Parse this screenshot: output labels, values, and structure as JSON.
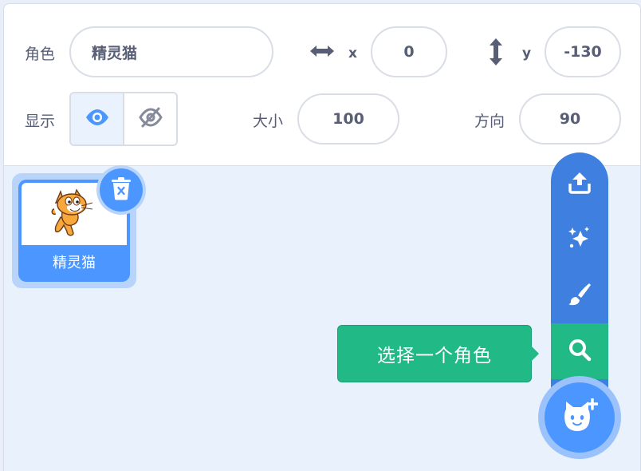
{
  "sprite_info": {
    "sprite_label": "角色",
    "sprite_name": "精灵猫",
    "x_label": "x",
    "x_value": "0",
    "y_label": "y",
    "y_value": "-130",
    "show_label": "显示",
    "size_label": "大小",
    "size_value": "100",
    "direction_label": "方向",
    "direction_value": "90",
    "visible": true
  },
  "sprite_list": [
    {
      "name": "精灵猫",
      "selected": true
    }
  ],
  "sprite_menu": {
    "items": [
      {
        "icon": "upload-icon"
      },
      {
        "icon": "surprise-sparkle-icon"
      },
      {
        "icon": "paint-brush-icon"
      },
      {
        "icon": "search-icon",
        "tooltip": "选择一个角色",
        "active": true
      }
    ],
    "main_icon": "add-cat-icon",
    "tooltip_text": "选择一个角色"
  },
  "colors": {
    "primary": "#4c97ff",
    "menu_bg": "#3f7fe0",
    "highlight": "#21b986",
    "text": "#575e75"
  }
}
